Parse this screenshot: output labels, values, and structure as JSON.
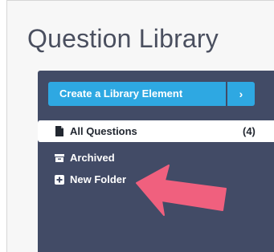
{
  "header": {
    "title": "Question Library"
  },
  "library": {
    "create_label": "Create a Library Element",
    "create_arrow": "›",
    "items": [
      {
        "label": "All Questions",
        "count": "(4)",
        "icon": "file-icon",
        "active": true
      },
      {
        "label": "Archived",
        "count": "",
        "icon": "archive-icon",
        "active": false
      },
      {
        "label": "New Folder",
        "count": "",
        "icon": "plus-box-icon",
        "active": false
      }
    ]
  },
  "colors": {
    "panel": "#424b66",
    "button": "#2ea8e2",
    "annotation_arrow": "#f0607e"
  },
  "annotation": {
    "icon": "pointer-arrow-icon"
  }
}
